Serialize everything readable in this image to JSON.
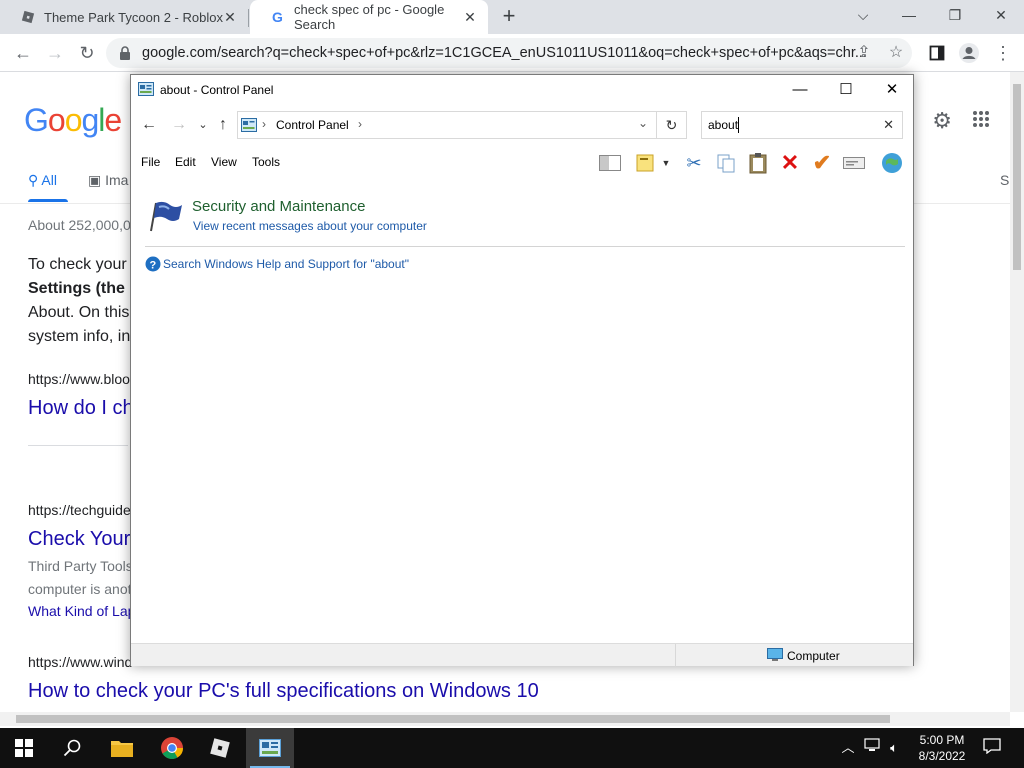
{
  "browser": {
    "tabs": [
      {
        "title": "Theme Park Tycoon 2 - Roblox",
        "active": false
      },
      {
        "title": "check spec of pc - Google Search",
        "active": true
      }
    ],
    "new_tab_label": "+",
    "url": "google.com/search?q=check+spec+of+pc&rlz=1C1GCEA_enUS1011US1011&oq=check+spec+of+pc&aqs=chr..."
  },
  "google": {
    "logo": "Google",
    "tabs": {
      "all": "All",
      "images": "Ima",
      "right_cut": "S"
    },
    "result_stats": "About 252,000,0",
    "snippet_lines": [
      "To check your",
      "Settings (the g",
      "About. On this",
      "system info, in"
    ],
    "results": [
      {
        "url": "https://www.bloo",
        "title": "How do I ch"
      },
      {
        "url": "https://techguide",
        "title": "Check Your",
        "snippet": [
          "Third Party Tools",
          "computer is anot"
        ],
        "sublink": "What Kind of Lap"
      },
      {
        "url": "https://www.wind",
        "title": "How to check your PC's full specifications on Windows 10"
      }
    ]
  },
  "control_panel": {
    "title": "about - Control Panel",
    "breadcrumb": "Control Panel",
    "search_value": "about",
    "menu": [
      "File",
      "Edit",
      "View",
      "Tools"
    ],
    "category_title": "Security and Maintenance",
    "category_link": "View recent messages about your computer",
    "help_link": "Search Windows Help and Support for \"about\"",
    "status_location": "Computer"
  },
  "taskbar": {
    "time": "5:00 PM",
    "date": "8/3/2022"
  }
}
